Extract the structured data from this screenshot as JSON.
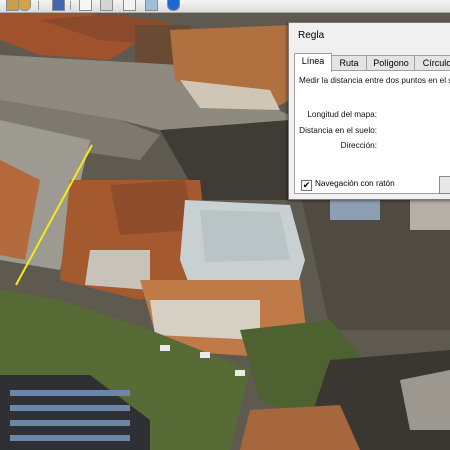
{
  "app": {
    "toolbar": {
      "icons": [
        "app-icon",
        "planet-icon",
        "book-icon",
        "mail-icon",
        "print-icon",
        "photo-icon",
        "earth-icon"
      ]
    },
    "colors": {
      "measure_line": "#f2ea1a",
      "dialog_bg": "#f0f0f0"
    }
  },
  "ruler": {
    "title": "Regla",
    "tabs": [
      "Línea",
      "Ruta",
      "Polígono",
      "Círculo"
    ],
    "active_tab": "Línea",
    "description": "Medir la distancia entre dos puntos en el s",
    "labels": {
      "map_length": "Longitud del mapa:",
      "ground_distance": "Distancia en el suelo:",
      "heading": "Dirección:"
    },
    "navigation_checkbox": {
      "label": "Navegación con ratón",
      "checked": true,
      "mark": "✔"
    }
  }
}
